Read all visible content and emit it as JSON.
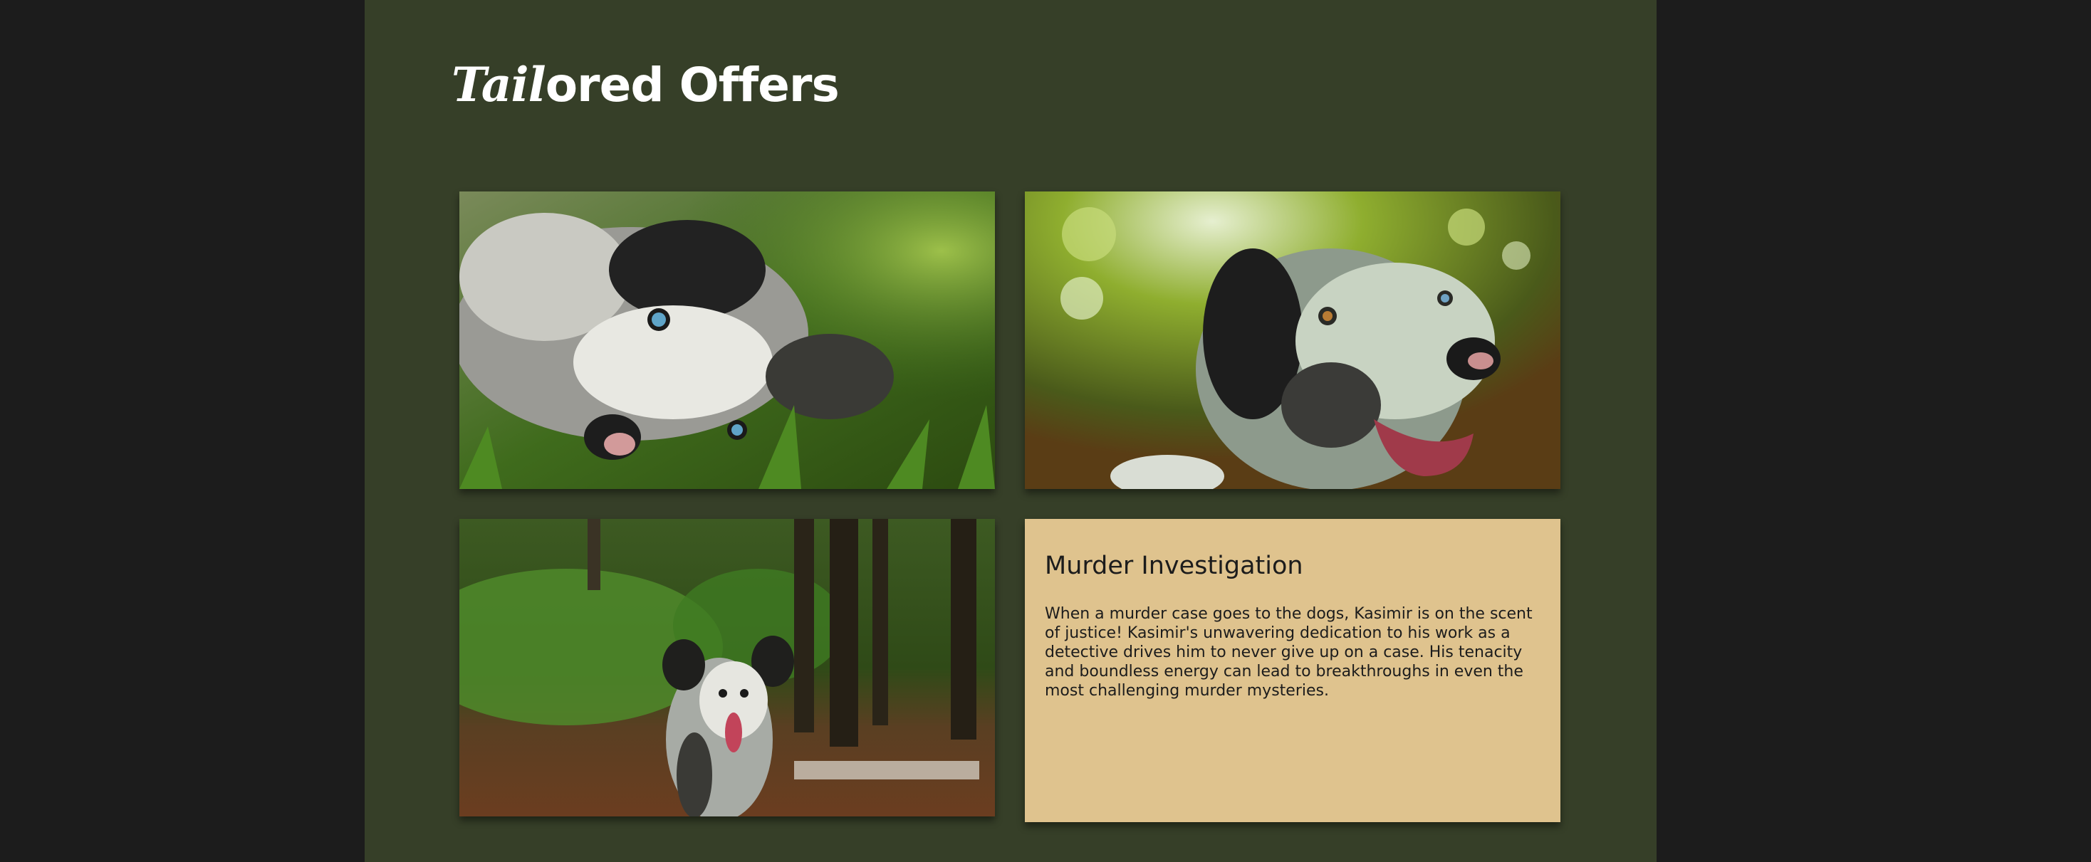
{
  "header": {
    "title_script": "Tail",
    "title_rest": "ored Offers"
  },
  "gallery": {
    "photos": [
      {
        "subject": "merle border collie lying in grass"
      },
      {
        "subject": "merle border collie smiling in forest"
      },
      {
        "subject": "merle border collie running on forest path"
      }
    ]
  },
  "offer": {
    "heading": "Murder Investigation",
    "description": "When a murder case goes to the dogs, Kasimir is on the scent of justice! Kasimir's unwavering dedication to his work as a detective drives him to never give up on a case. His tenacity and boundless energy can lead to breakthroughs in even the most challenging murder mysteries."
  },
  "colors": {
    "page_background": "#363f28",
    "outer_background": "#1c1c1c",
    "card_accent": "#dfc38e",
    "text_dark": "#1c1c1c"
  }
}
